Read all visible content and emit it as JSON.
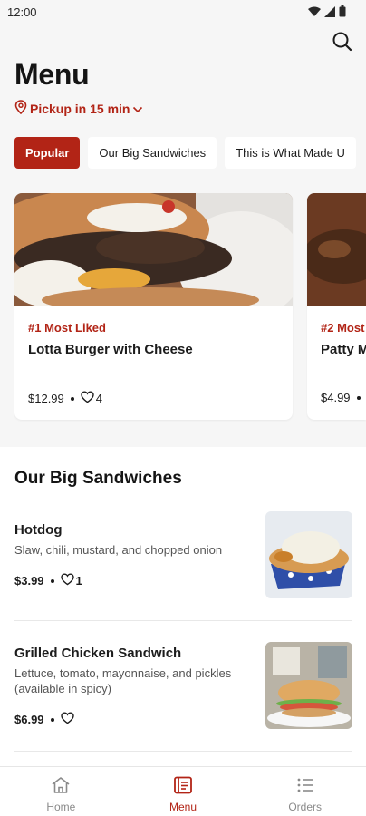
{
  "status_bar": {
    "time": "12:00"
  },
  "header": {
    "title": "Menu",
    "pickup_label": "Pickup in 15 min"
  },
  "tabs": [
    {
      "label": "Popular",
      "active": true
    },
    {
      "label": "Our Big Sandwiches",
      "active": false
    },
    {
      "label": "This is What Made U",
      "active": false
    }
  ],
  "popular": [
    {
      "rank": "#1 Most Liked",
      "name": "Lotta Burger with Cheese",
      "price": "$12.99",
      "likes": "4"
    },
    {
      "rank": "#2 Most",
      "name": "Patty M",
      "price": "$4.99",
      "likes": ""
    }
  ],
  "section": {
    "title": "Our Big Sandwiches",
    "items": [
      {
        "name": "Hotdog",
        "description": "Slaw, chili, mustard, and chopped onion",
        "price": "$3.99",
        "likes": "1"
      },
      {
        "name": "Grilled Chicken Sandwich",
        "description": "Lettuce, tomato, mayonnaise, and pickles (available in spicy)",
        "price": "$6.99",
        "likes": ""
      }
    ]
  },
  "bottom_nav": [
    {
      "label": "Home",
      "icon": "home-icon",
      "active": false
    },
    {
      "label": "Menu",
      "icon": "menu-book-icon",
      "active": true
    },
    {
      "label": "Orders",
      "icon": "list-icon",
      "active": false
    }
  ],
  "colors": {
    "accent": "#b22416",
    "background": "#f6f6f6",
    "text": "#1c1c1c"
  }
}
